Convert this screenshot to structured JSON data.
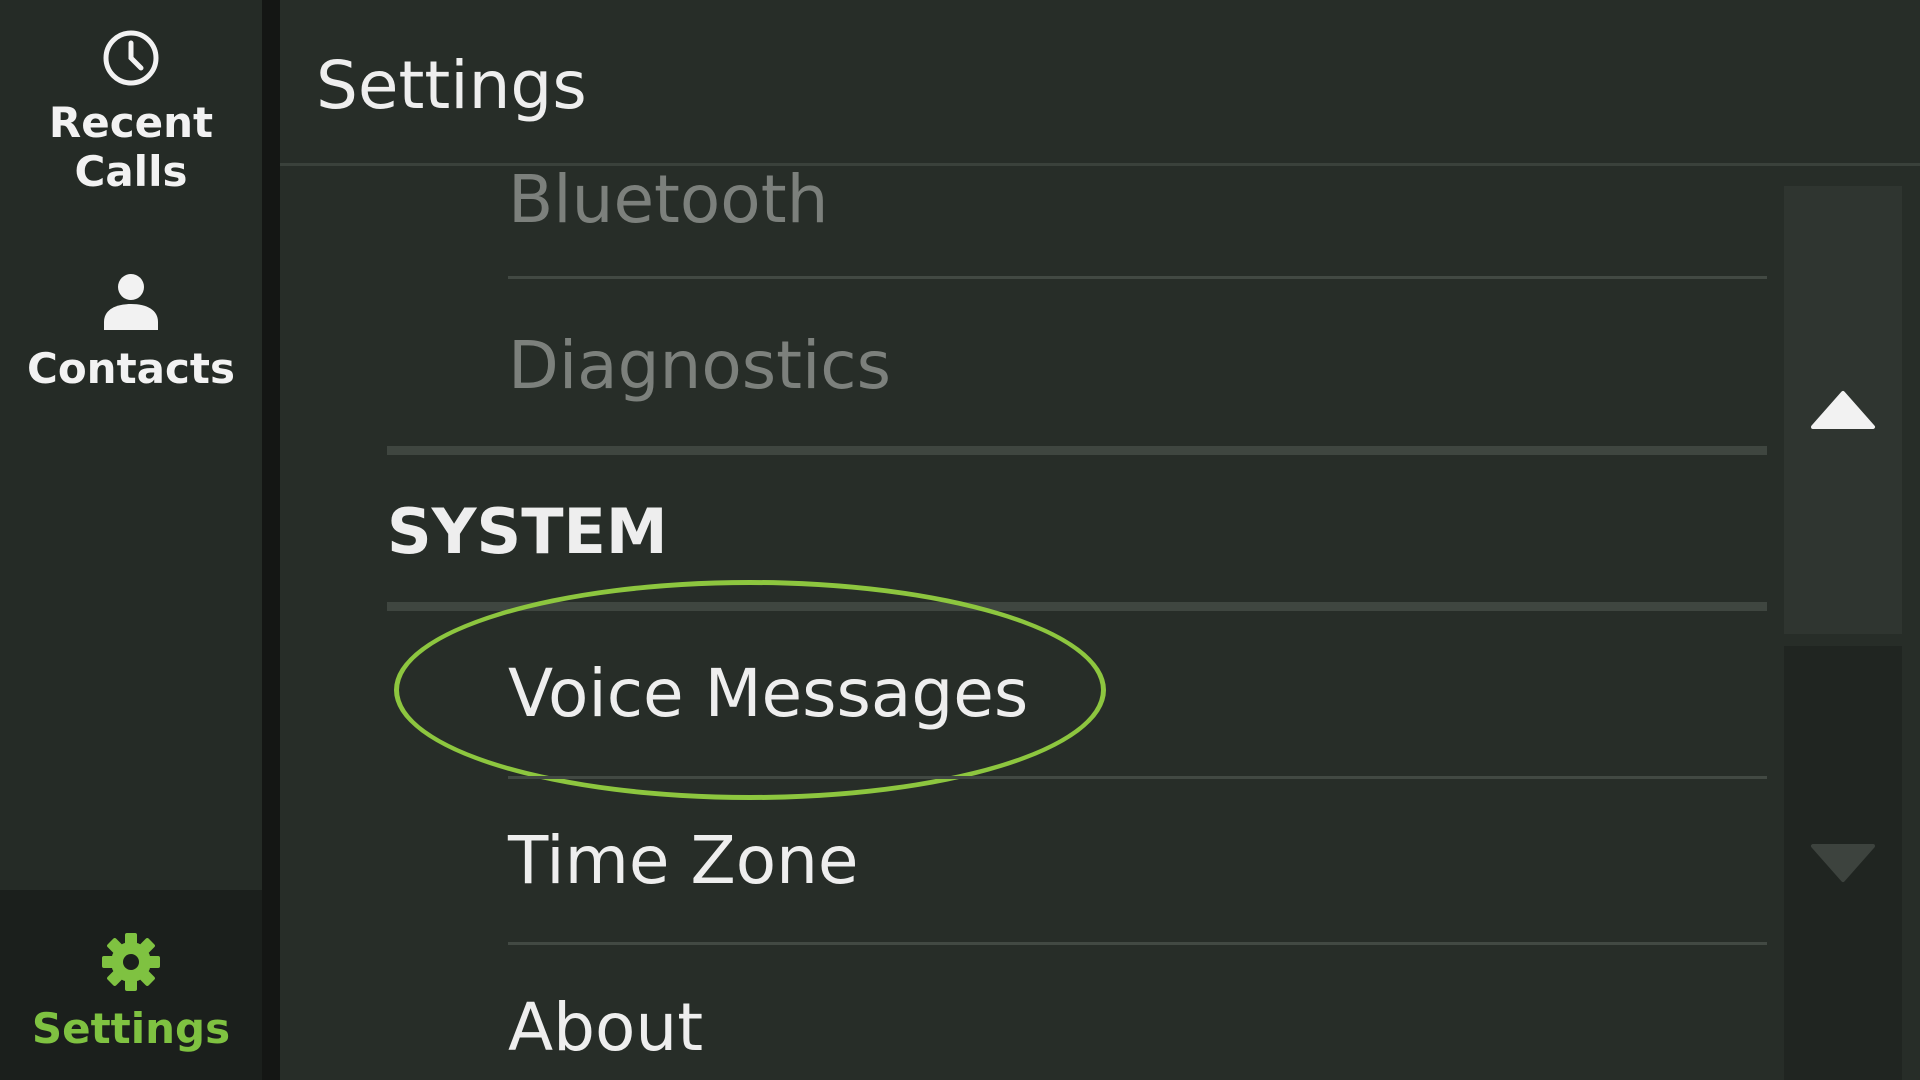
{
  "sidebar": {
    "recent_calls": {
      "label": "Recent\nCalls",
      "icon": "clock-icon"
    },
    "contacts": {
      "label": "Contacts",
      "icon": "person-icon"
    },
    "settings": {
      "label": "Settings",
      "icon": "gear-icon",
      "active": true
    }
  },
  "header": {
    "title": "Settings"
  },
  "list": {
    "items_above": [
      {
        "label": "Bluetooth",
        "enabled": false
      },
      {
        "label": "Diagnostics",
        "enabled": false
      }
    ],
    "section": {
      "title": "SYSTEM",
      "items": [
        {
          "label": "Voice Messages",
          "highlighted": true
        },
        {
          "label": "Time Zone"
        },
        {
          "label": "About"
        }
      ]
    }
  },
  "scroll": {
    "up_icon": "triangle-up-icon",
    "down_icon": "triangle-down-icon",
    "down_enabled": false
  },
  "colors": {
    "accent": "#7fc241",
    "highlight_ring": "#8dc63f",
    "panel": "#272d28",
    "sidebar": "#252b26"
  }
}
